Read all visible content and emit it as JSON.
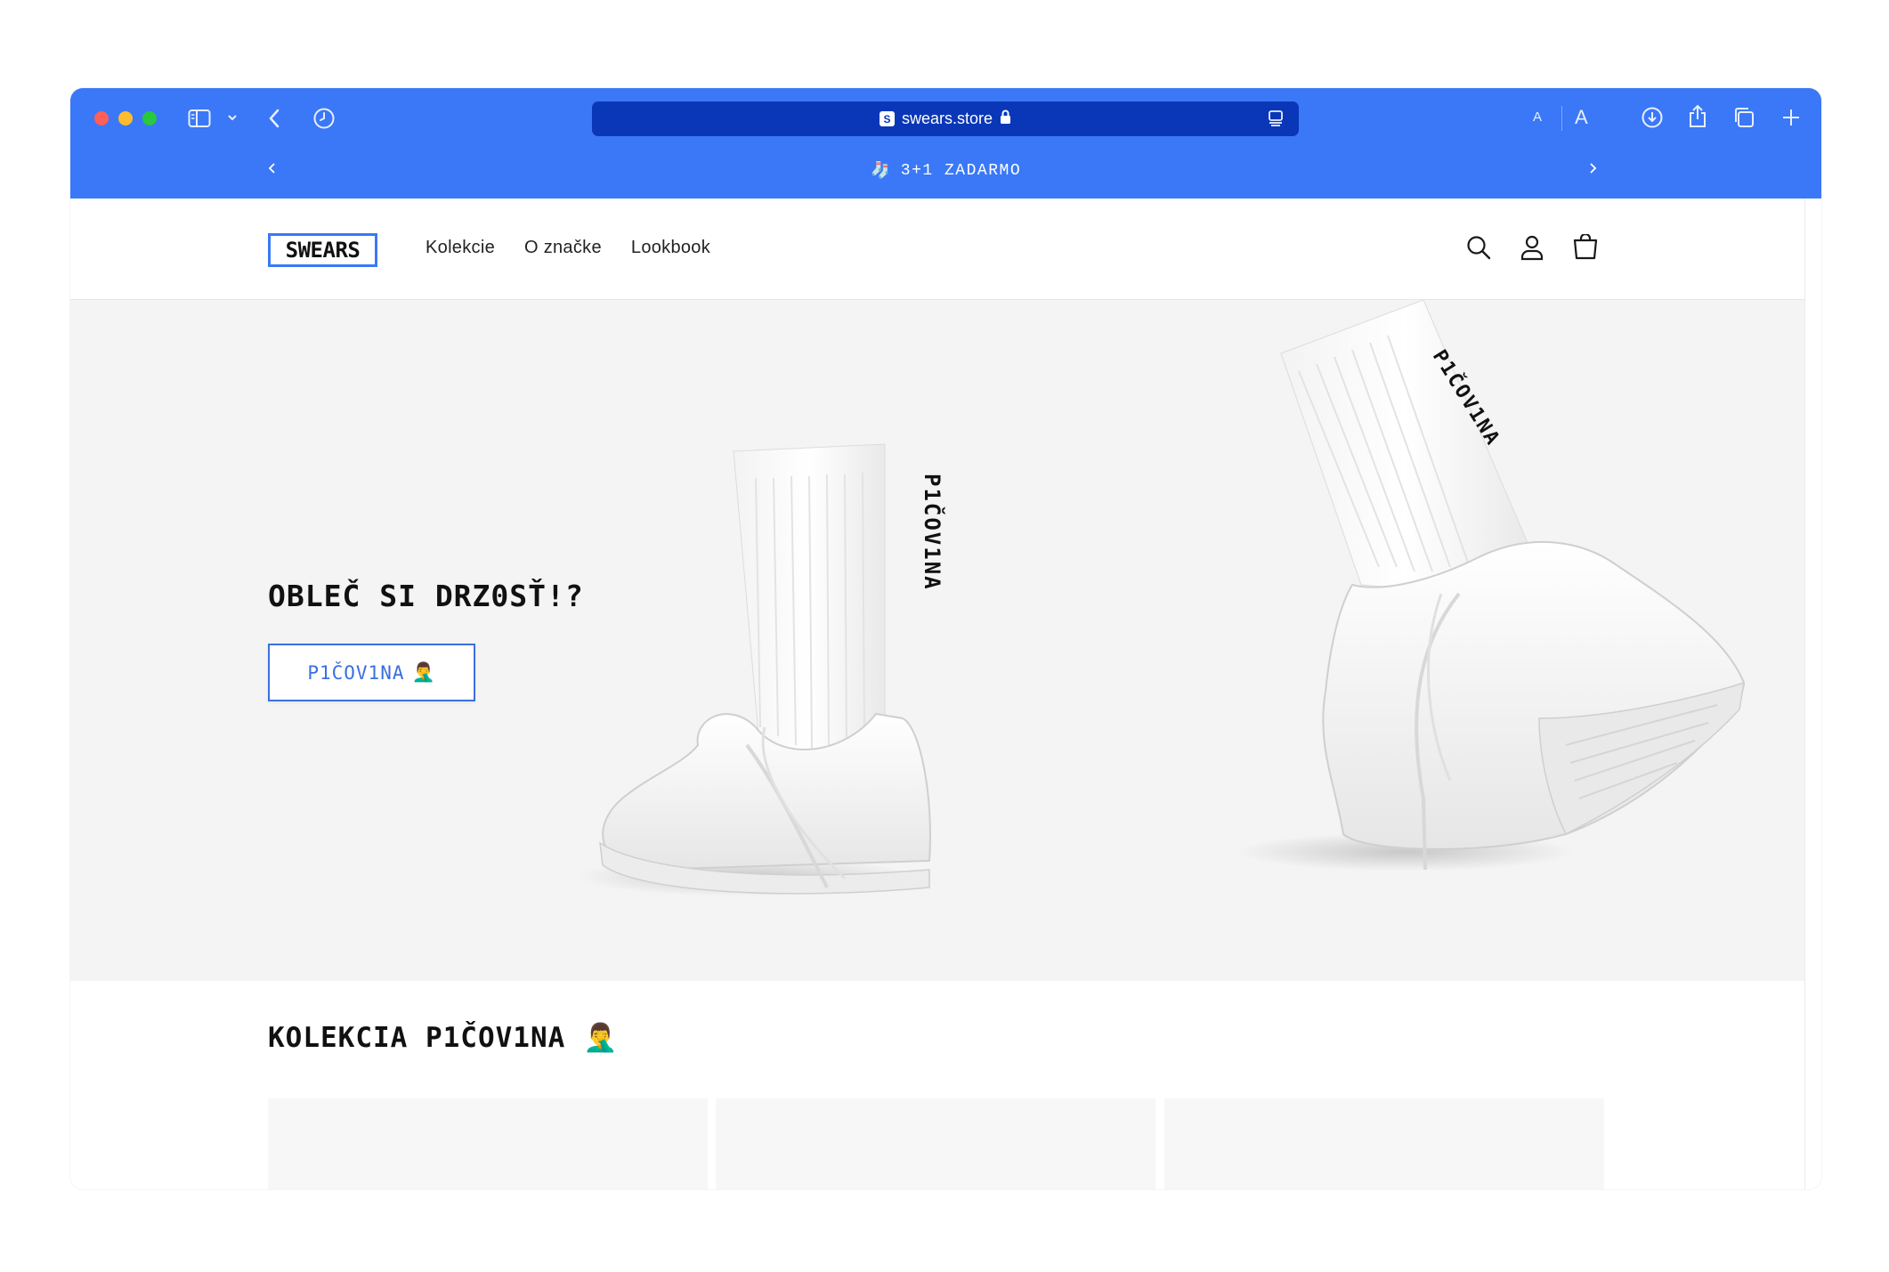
{
  "browser": {
    "url": "swears.store",
    "favicon_letter": "S",
    "font_small_label": "A",
    "font_large_label": "A"
  },
  "announcement": {
    "emoji": "🧦",
    "text": "3+1 ZADARMO"
  },
  "site": {
    "logo_text": "SWEARS",
    "nav": [
      "Kolekcie",
      "O značke",
      "Lookbook"
    ],
    "icons": [
      "search-icon",
      "account-icon",
      "cart-icon"
    ]
  },
  "hero": {
    "title_regular": "OBLEČ SI ",
    "title_bold": "DRZ0SŤ!?",
    "button_label": "P1ČOV1NA",
    "button_emoji": "🤦‍♂️",
    "sock_text": "P1ČOV1NA"
  },
  "collection": {
    "title": "KOLEKCIA P1ČOV1NA",
    "title_emoji": "🤦‍♂️",
    "cards": 3
  },
  "colors": {
    "accent": "#3a78f7",
    "url_bar": "#0a37b8",
    "hero_bg": "#f4f4f4"
  }
}
